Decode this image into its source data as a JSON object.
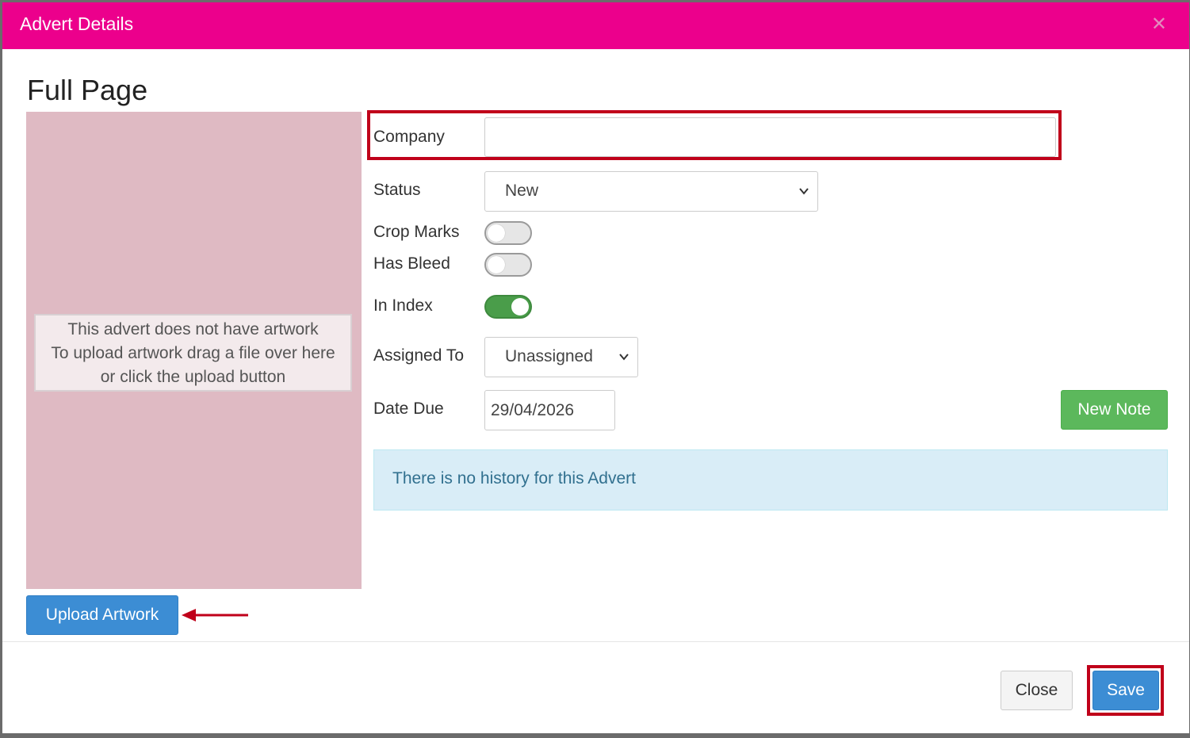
{
  "modal": {
    "title": "Advert Details",
    "close_icon": "close-icon",
    "header_color": "#ec008c"
  },
  "page_title": "Full Page",
  "artwork": {
    "message_line1": "This advert does not have artwork",
    "message_line2": "To upload artwork drag a file over here",
    "message_line3": "or click the upload button",
    "upload_label": "Upload Artwork"
  },
  "form": {
    "company": {
      "label": "Company",
      "value": ""
    },
    "status": {
      "label": "Status",
      "selected": "New"
    },
    "crop_marks": {
      "label": "Crop Marks",
      "checked": false
    },
    "has_bleed": {
      "label": "Has Bleed",
      "checked": false
    },
    "in_index": {
      "label": "In Index",
      "checked": true
    },
    "assigned_to": {
      "label": "Assigned To",
      "selected": "Unassigned"
    },
    "date_due": {
      "label": "Date Due",
      "value": "29/04/2026"
    }
  },
  "new_note_label": "New Note",
  "history_message": "There is no history for this Advert",
  "footer": {
    "close_label": "Close",
    "save_label": "Save"
  }
}
